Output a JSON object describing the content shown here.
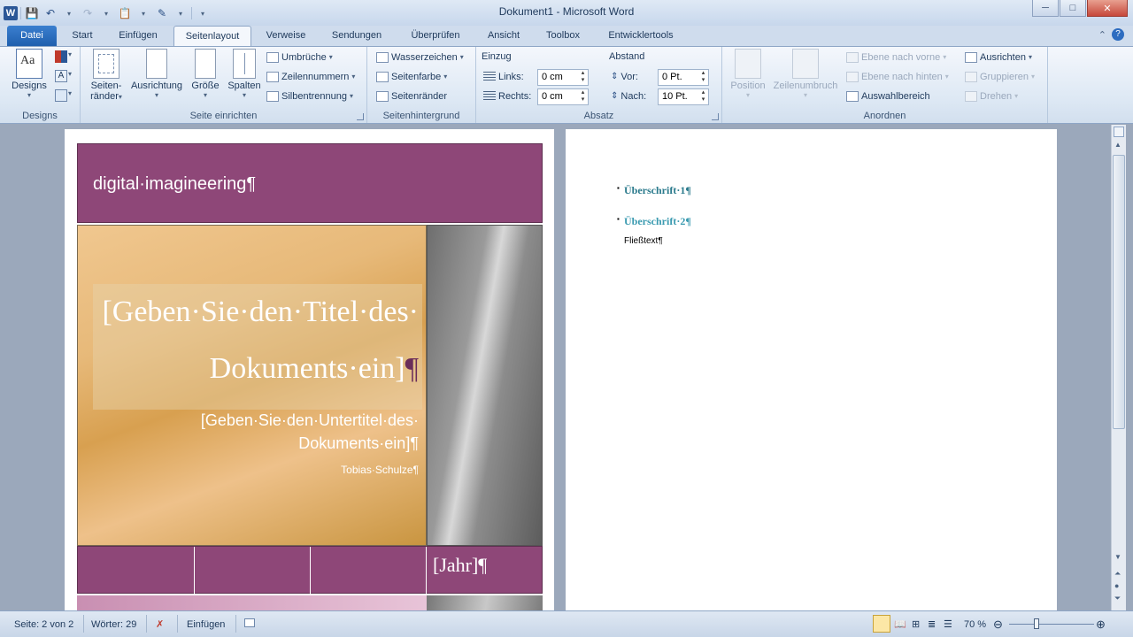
{
  "window": {
    "title": "Dokument1  -  Microsoft Word"
  },
  "qat": {
    "logo": "W"
  },
  "ribbon_tabs": [
    "Datei",
    "Start",
    "Einfügen",
    "Seitenlayout",
    "Verweise",
    "Sendungen",
    "Überprüfen",
    "Ansicht",
    "Toolbox",
    "Entwicklertools"
  ],
  "groups": {
    "designs": {
      "label": "Designs",
      "button": "Designs"
    },
    "page_setup": {
      "label": "Seite einrichten",
      "margins": "Seiten-\nränder",
      "margins_l1": "Seiten-",
      "margins_l2": "ränder",
      "orientation": "Ausrichtung",
      "size": "Größe",
      "columns": "Spalten",
      "breaks": "Umbrüche",
      "line_numbers": "Zeilennummern",
      "hyphenation": "Silbentrennung"
    },
    "background": {
      "label": "Seitenhintergrund",
      "watermark": "Wasserzeichen",
      "page_color": "Seitenfarbe",
      "page_borders": "Seitenränder"
    },
    "paragraph": {
      "label": "Absatz",
      "indent": "Einzug",
      "left": "Links:",
      "right": "Rechts:",
      "left_value": "0 cm",
      "right_value": "0 cm",
      "spacing": "Abstand",
      "before": "Vor:",
      "after": "Nach:",
      "before_value": "0 Pt.",
      "after_value": "10 Pt."
    },
    "arrange": {
      "label": "Anordnen",
      "position": "Position",
      "wrap": "Zeilenumbruch",
      "bring_forward": "Ebene nach vorne",
      "send_backward": "Ebene nach hinten",
      "selection_pane": "Auswahlbereich",
      "align": "Ausrichten",
      "group": "Gruppieren",
      "rotate": "Drehen"
    }
  },
  "page1": {
    "header_text": "digital·imagineering¶",
    "title_line1": "[Geben·Sie·den·Titel·des·",
    "title_line2": "Dokuments·ein]",
    "pilcrow": "¶",
    "subtitle_line1": "[Geben·Sie·den·Untertitel·des·",
    "subtitle_line2": "Dokuments·ein]¶",
    "author": "Tobias·Schulze¶",
    "year": "[Jahr]¶"
  },
  "page2": {
    "heading1": "Überschrift·1¶",
    "heading2": "Überschrift·2¶",
    "body": "Fließtext¶"
  },
  "status": {
    "page": "Seite: 2 von 2",
    "words": "Wörter: 29",
    "mode": "Einfügen",
    "zoom": "70 %",
    "zoom_level": 0.7
  },
  "colors": {
    "accent": "#8e4778",
    "heading": "#2a7a8c"
  }
}
